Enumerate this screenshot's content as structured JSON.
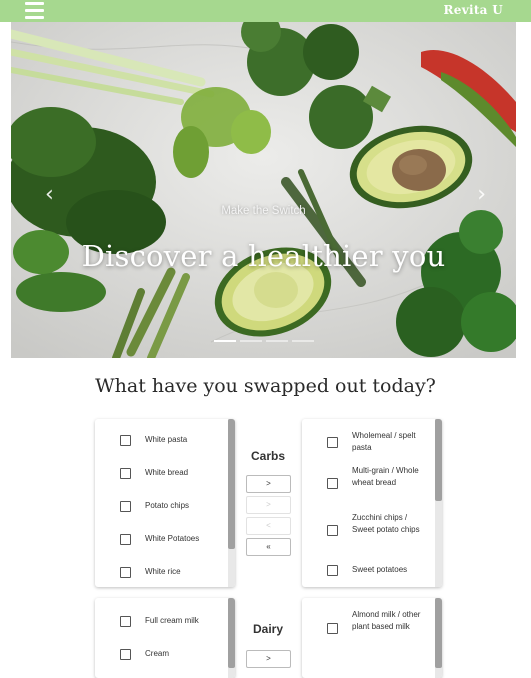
{
  "header": {
    "brand": "Revita U",
    "menu_icon": "hamburger-menu-icon",
    "bg_color": "#a6d88f"
  },
  "hero": {
    "subtitle": "Make the Switch",
    "title": "Discover a healthier you",
    "prev_icon": "chevron-left-icon",
    "next_icon": "chevron-right-icon",
    "slides": 4,
    "active_slide": 1
  },
  "question": "What have you swapped out today?",
  "groups": [
    {
      "category": "Carbs",
      "left": [
        "White pasta",
        "White bread",
        "Potato chips",
        "White Potatoes",
        "White rice"
      ],
      "right": [
        "Wholemeal / spelt pasta",
        "Multi-grain / Whole wheat bread",
        "Zucchini chips / Sweet potato chips",
        "Sweet potatoes"
      ],
      "buttons": [
        ">",
        ">",
        "<",
        "«"
      ]
    },
    {
      "category": "Dairy",
      "left": [
        "Full cream milk",
        "Cream"
      ],
      "right": [
        "Almond milk / other plant based milk"
      ],
      "buttons": [
        ">"
      ]
    }
  ]
}
